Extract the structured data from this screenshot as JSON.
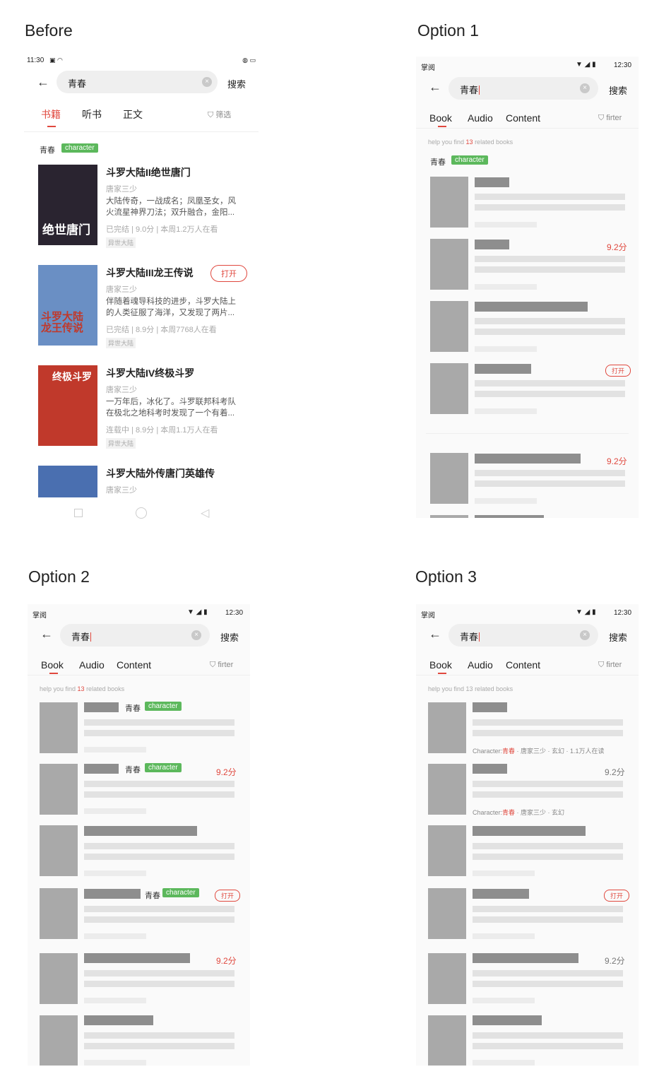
{
  "captions": {
    "before": "Before",
    "option1": "Option 1",
    "option2": "Option 2",
    "option3": "Option 3"
  },
  "before": {
    "status_time": "11:30",
    "search_query": "青春",
    "search_button": "搜索",
    "tabs": [
      "书籍",
      "听书",
      "正文"
    ],
    "filter_label": "筛选",
    "character_keyword": "青春",
    "character_tag": "character",
    "open_button": "打开",
    "books": [
      {
        "title": "斗罗大陆II绝世唐门",
        "author": "唐家三少",
        "desc": "大陆传奇，一战成名；凤凰圣女，风火流星神界刀法；双升融合，金阳...",
        "status": "已完结 | 9.0分 | 本周1.2万人在看",
        "category": "异世大陆",
        "cover_text": "绝世唐门",
        "cover_color": "#2a2430"
      },
      {
        "title": "斗罗大陆III龙王传说",
        "author": "唐家三少",
        "desc": "伴随着魂导科技的进步，斗罗大陆上的人类征服了海洋，又发现了两片...",
        "status": "已完结 | 8.9分 | 本周7768人在看",
        "category": "异世大陆",
        "cover_text": "斗罗大陆 龙王传说",
        "cover_color": "#6a8fc4"
      },
      {
        "title": "斗罗大陆IV终极斗罗",
        "author": "唐家三少",
        "desc": "一万年后，冰化了。斗罗联邦科考队在极北之地科考时发现了一个有着...",
        "status": "连载中 | 8.9分 | 本周1.1万人在看",
        "category": "异世大陆",
        "cover_text": "终极斗罗",
        "cover_color": "#c0392b"
      },
      {
        "title": "斗罗大陆外传唐门英雄传",
        "author": "唐家三少",
        "cover_text": "",
        "cover_color": "#4a6fb0"
      }
    ]
  },
  "option_common": {
    "app_name": "掌阅",
    "status_time": "12:30",
    "search_query": "青春",
    "search_button": "搜索",
    "tabs": [
      "Book",
      "Audio",
      "Content"
    ],
    "filter_label": "firter",
    "hint_prefix": "help you find ",
    "hint_count": "13",
    "hint_suffix": " related books",
    "character_keyword": "青春",
    "character_tag": "character",
    "score": "9.2分",
    "open_button": "打开"
  },
  "option3_meta": {
    "row1_prefix": "Character:",
    "row1_keyword": "青春",
    "row1_rest": " · 唐家三少 · 玄幻 · 1.1万人在读",
    "row2_prefix": "Character:",
    "row2_keyword": "青春",
    "row2_rest": " · 唐家三少 · 玄幻"
  },
  "colors": {
    "accent": "#e0483e",
    "tag_green": "#5cb85c",
    "placeholder_dark": "#8e8e8e",
    "placeholder_light": "#e2e2e2"
  }
}
